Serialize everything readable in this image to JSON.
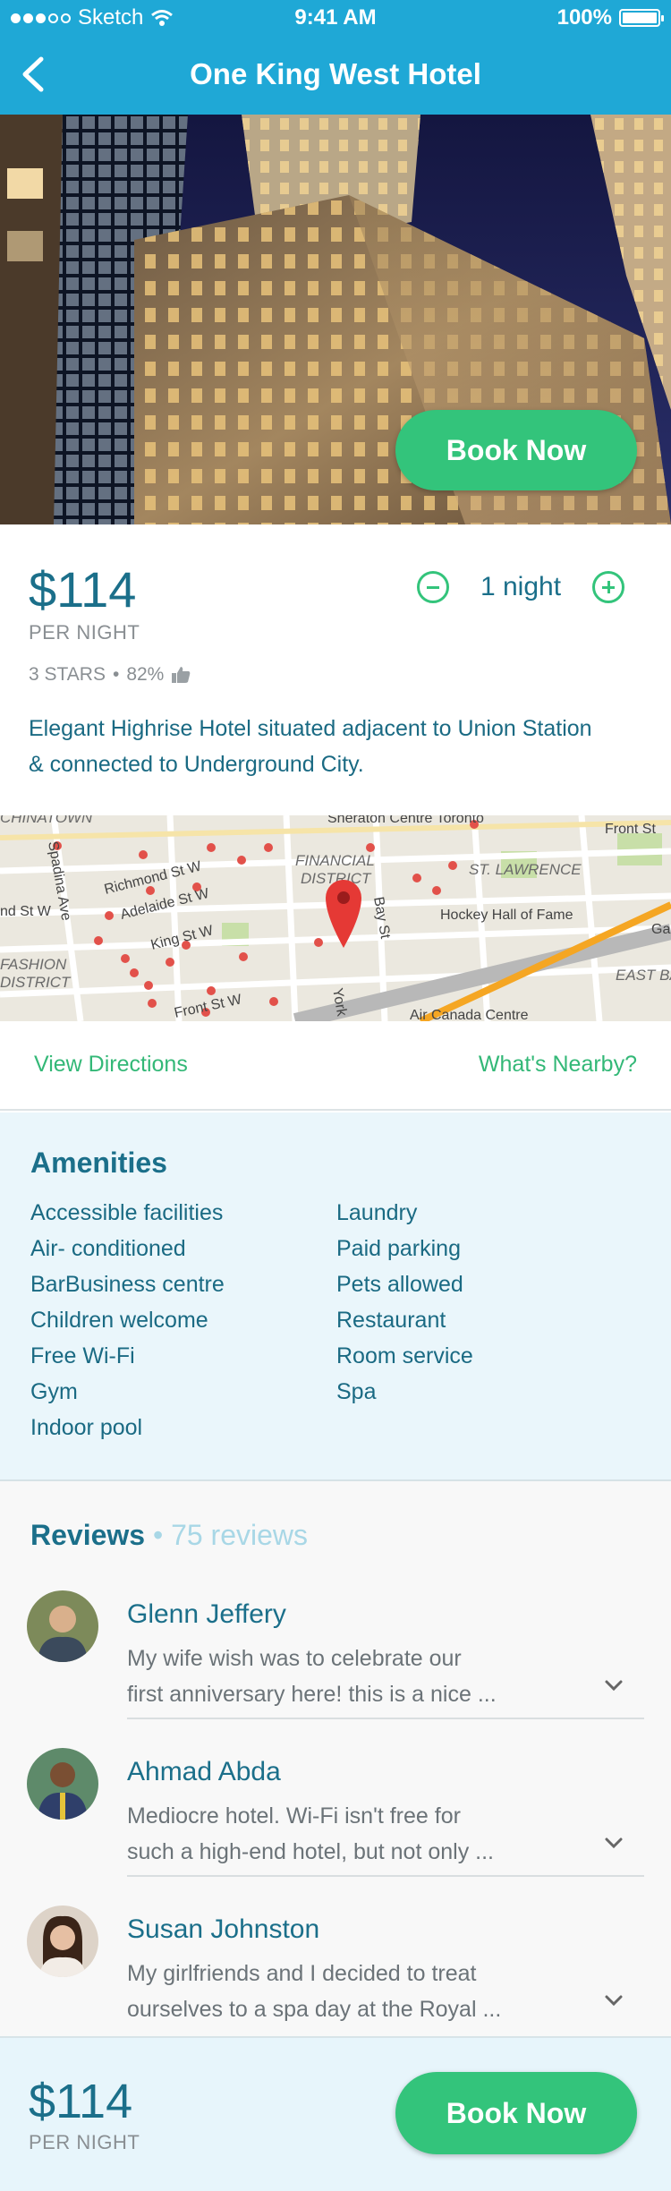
{
  "status_bar": {
    "carrier": "Sketch",
    "time": "9:41 AM",
    "battery": "100%"
  },
  "nav": {
    "title": "One King West Hotel",
    "back_icon": "chevron-left-icon"
  },
  "hero": {
    "book_label": "Book Now"
  },
  "pricing": {
    "price": "$114",
    "per_night": "PER NIGHT",
    "nights": "1 night"
  },
  "rating": {
    "stars": "3 STARS",
    "separator": "•",
    "percent": "82%",
    "icon": "thumbs-up-icon"
  },
  "description": "Elegant Highrise Hotel situated adjacent to Union Station & connected to Underground City.",
  "map": {
    "labels": {
      "chinatown": "CHINATOWN",
      "sheraton": "Sheraton Centre Toronto",
      "front_st_right": "Front St",
      "spadina": "Spadina Ave",
      "richmond": "Richmond St W",
      "adelaide": "Adelaide St W",
      "financial": "FINANCIAL",
      "district": "DISTRICT",
      "st_lawrence": "ST. LAWRENCE",
      "nd_st_w": "nd St W",
      "king": "King St W",
      "bay": "Bay St",
      "hockey": "Hockey Hall of Fame",
      "fashion": "FASHION",
      "district2": "DISTRICT",
      "front_st_left": "Front St W",
      "york": "York",
      "east_ba": "EAST BA",
      "air_canada": "Air Canada Centre",
      "ga": "Ga"
    }
  },
  "links": {
    "directions": "View Directions",
    "nearby": "What's Nearby?"
  },
  "amenities": {
    "title": "Amenities",
    "left": [
      "Accessible facilities",
      "Air- conditioned",
      "BarBusiness centre",
      "Children welcome",
      "Free Wi-Fi",
      "Gym",
      "Indoor pool"
    ],
    "right": [
      "Laundry",
      "Paid parking",
      "Pets allowed",
      "Restaurant",
      "Room service",
      "Spa"
    ]
  },
  "reviews": {
    "title": "Reviews",
    "count": "• 75 reviews",
    "items": [
      {
        "name": "Glenn Jeffery",
        "line1": "My wife wish was to celebrate our",
        "line2": "first anniversary here! this is a nice ..."
      },
      {
        "name": "Ahmad Abda",
        "line1": "Mediocre hotel. Wi-Fi isn't free for",
        "line2": "such a high-end hotel, but not only ..."
      },
      {
        "name": "Susan Johnston",
        "line1": "My girlfriends and I decided to treat",
        "line2": "ourselves to a spa day at the Royal ..."
      }
    ]
  },
  "bottom": {
    "price": "$114",
    "per_night": "PER NIGHT",
    "book_label": "Book Now"
  },
  "colors": {
    "primary": "#1fa8d6",
    "accent": "#33c47b",
    "text": "#1b6f8a"
  }
}
